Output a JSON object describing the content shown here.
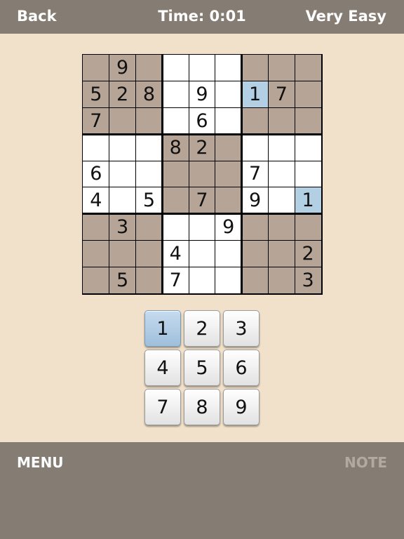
{
  "header": {
    "back_label": "Back",
    "time": "Time: 0:01",
    "difficulty": "Very Easy"
  },
  "footer": {
    "menu_label": "MENU",
    "note_label": "NOTE"
  },
  "board": {
    "cells": [
      [
        "",
        "9",
        "",
        "",
        "",
        "",
        "",
        "",
        ""
      ],
      [
        "5",
        "2",
        "8",
        "",
        "9",
        "",
        "1",
        "7",
        ""
      ],
      [
        "7",
        "",
        "",
        "",
        "6",
        "",
        "",
        "",
        ""
      ],
      [
        "",
        "",
        "",
        "8",
        "2",
        "",
        "",
        "",
        ""
      ],
      [
        "6",
        "",
        "",
        "",
        "",
        "",
        "7",
        "",
        ""
      ],
      [
        "4",
        "",
        "5",
        "",
        "7",
        "",
        "9",
        "",
        "1"
      ],
      [
        "",
        "3",
        "",
        "",
        "",
        "9",
        "",
        "",
        ""
      ],
      [
        "",
        "",
        "",
        "4",
        "",
        "",
        "",
        "",
        "2"
      ],
      [
        "",
        "5",
        "",
        "7",
        "",
        "",
        "",
        "",
        "3"
      ]
    ],
    "highlighted": [
      [
        1,
        6
      ],
      [
        5,
        8
      ]
    ],
    "shaded_boxes": [
      0,
      2,
      4,
      6,
      8
    ]
  },
  "numpad": {
    "keys": [
      "1",
      "2",
      "3",
      "4",
      "5",
      "6",
      "7",
      "8",
      "9"
    ],
    "selected": "1"
  },
  "colors": {
    "background": "#f1e1ca",
    "bar": "#857c73",
    "shaded_cell": "#b6a596",
    "highlight": "#b3cfe4",
    "disabled_text": "#b1aaa3"
  }
}
